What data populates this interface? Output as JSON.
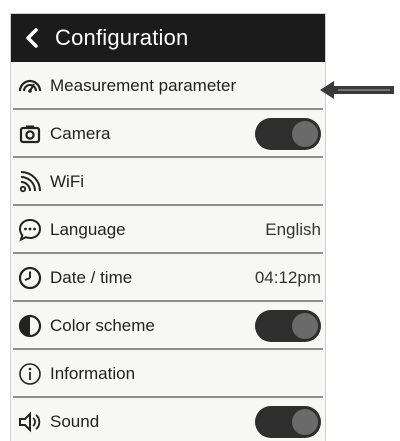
{
  "header": {
    "title": "Configuration",
    "back_icon": "chevron-left-icon"
  },
  "menu": [
    {
      "key": "measurement",
      "label": "Measurement parameter",
      "icon": "gauge-icon"
    },
    {
      "key": "camera",
      "label": "Camera",
      "icon": "camera-icon",
      "toggle": "on"
    },
    {
      "key": "wifi",
      "label": "WiFi",
      "icon": "wifi-icon"
    },
    {
      "key": "language",
      "label": "Language",
      "icon": "chat-icon",
      "value": "English"
    },
    {
      "key": "datetime",
      "label": "Date / time",
      "icon": "clock-icon",
      "value": "04:12pm"
    },
    {
      "key": "color",
      "label": "Color scheme",
      "icon": "contrast-icon",
      "toggle": "on"
    },
    {
      "key": "info",
      "label": "Information",
      "icon": "info-icon"
    },
    {
      "key": "sound",
      "label": "Sound",
      "icon": "speaker-icon",
      "toggle": "on"
    }
  ],
  "annotation": {
    "icon": "left-arrow-icon"
  },
  "colors": {
    "header_bg": "#1b1b1b",
    "toggle_track": "#2e2e2e",
    "toggle_knob": "#6a6a6a",
    "divider": "#8f8f8f"
  }
}
